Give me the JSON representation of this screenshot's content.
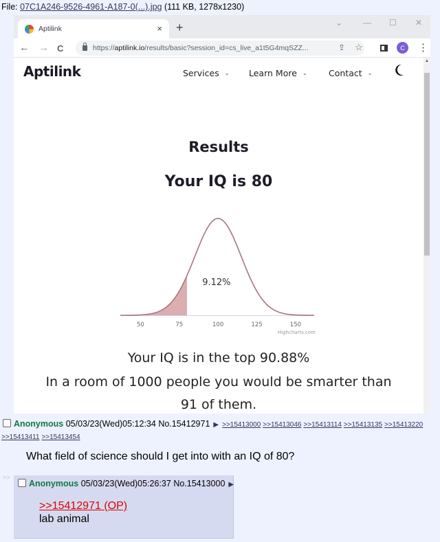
{
  "file_info": {
    "label": "File: ",
    "filename": "07C1A246-9526-4961-A187-0(...).jpg",
    "meta": " (111 KB, 1278x1230)"
  },
  "browser": {
    "tab_title": "Aptilink",
    "tab_close": "×",
    "new_tab": "+",
    "window_controls": {
      "dropdown": "⌄",
      "minimize": "—",
      "maximize": "☐",
      "close": "✕"
    },
    "nav": {
      "back": "←",
      "forward": "→",
      "reload": "C"
    },
    "url_prefix": "https://",
    "url_domain": "aptilink.io",
    "url_rest": "/results/basic?session_id=cs_live_a1t5G4mqSZZ...",
    "profile_initial": "C",
    "icons": [
      "share-icon",
      "star-icon",
      "side-panel-icon",
      "profile-icon",
      "more-icon"
    ]
  },
  "site": {
    "brand": "Aptilink",
    "nav": [
      {
        "label": "Services"
      },
      {
        "label": "Learn More"
      },
      {
        "label": "Contact"
      }
    ],
    "theme_toggle": "moon-icon",
    "results_heading": "Results",
    "iq_heading": "Your IQ is 80",
    "top_line": "Your IQ is in the top 90.88%",
    "room_line": "In a room of 1000 people you would be smarter than",
    "room_line2": "91 of them."
  },
  "chart_data": {
    "type": "area",
    "title": "",
    "description": "Normal distribution of IQ (mean 100, sd 15) with shaded left tail up to the user's score",
    "mean": 100,
    "sd": 15,
    "shaded_to": 80,
    "shaded_label": "9.12%",
    "x_ticks": [
      50,
      75,
      100,
      125,
      150
    ],
    "xlim": [
      37,
      162
    ],
    "xlabel": "",
    "ylabel": "",
    "credits": "Highcharts.com",
    "colors": {
      "line": "#a8747c",
      "fill": "#dcaeb2"
    }
  },
  "thread": {
    "op": {
      "name": "Anonymous",
      "datetime": "05/03/23(Wed)05:12:34",
      "number": "No.15412971",
      "backlinks_row1": [
        ">>15413000",
        ">>15413046",
        ">>15413114",
        ">>15413135",
        ">>15413220"
      ],
      "backlinks_row2": [
        ">>15413411",
        ">>15413454"
      ],
      "comment": "What field of science should I get into with an IQ of 80?"
    },
    "reply": {
      "side_arrows": ">>",
      "name": "Anonymous",
      "datetime": "05/03/23(Wed)05:26:37",
      "number": "No.15413000",
      "quote": ">>15412971 (OP)",
      "comment": "lab animal"
    }
  }
}
